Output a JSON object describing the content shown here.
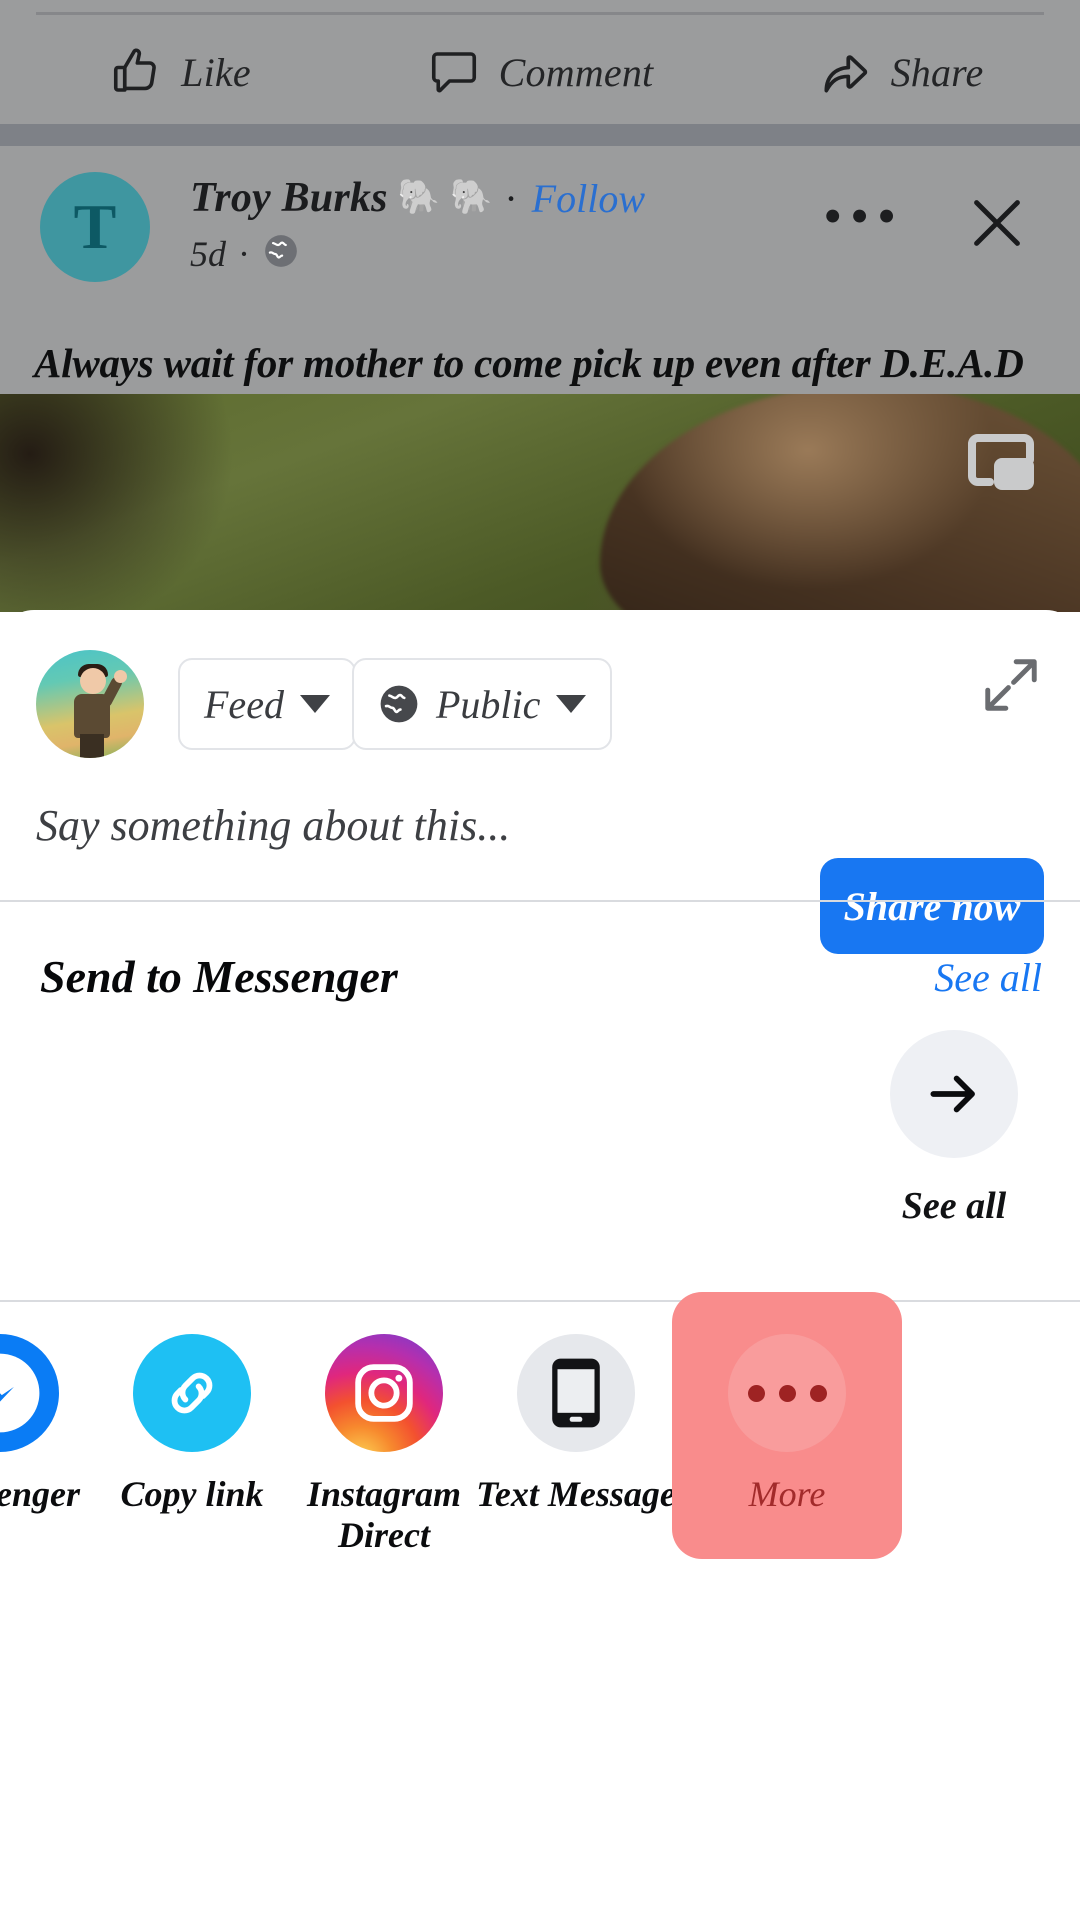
{
  "action_bar": {
    "items": [
      {
        "label": "Like",
        "icon": "thumbs-up-icon"
      },
      {
        "label": "Comment",
        "icon": "comment-bubble-icon"
      },
      {
        "label": "Share",
        "icon": "share-arrow-icon"
      }
    ]
  },
  "post": {
    "avatar_initial": "T",
    "author": "Troy Burks",
    "emoji": [
      "🐘",
      "🐘"
    ],
    "separator": "·",
    "follow_label": "Follow",
    "time": "5d",
    "time_separator": "·",
    "privacy_icon": "globe-icon",
    "more_icon": "ellipsis-icon",
    "close_icon": "close-icon",
    "text": "Always wait for  mother to come pick  up even after D.E.A.D",
    "pip_icon": "picture-in-picture-icon"
  },
  "composer": {
    "avatar": "user-avatar",
    "chips": [
      {
        "label": "Feed",
        "icon": null,
        "caret": "chevron-down-icon"
      },
      {
        "label": "Public",
        "icon": "globe-icon",
        "caret": "chevron-down-icon"
      }
    ],
    "placeholder": "Say something about this...",
    "expand_icon": "expand-arrows-icon",
    "share_now_label": "Share now"
  },
  "messenger": {
    "title": "Send to Messenger",
    "see_all_link": "See all",
    "see_all_tile": {
      "icon": "arrow-right-icon",
      "caption": "See all"
    }
  },
  "app_row": [
    {
      "name": "messenger",
      "label": "Messenger",
      "icon": "messenger-icon",
      "two_line": false
    },
    {
      "name": "copylink",
      "label": "Copy link",
      "icon": "link-icon",
      "two_line": false
    },
    {
      "name": "instagram",
      "label": "Instagram Direct",
      "icon": "instagram-icon",
      "two_line": true
    },
    {
      "name": "textmessage",
      "label": "Text Message",
      "icon": "phone-icon",
      "two_line": false
    },
    {
      "name": "more",
      "label": "More",
      "icon": "ellipsis-icon",
      "two_line": false
    }
  ],
  "colors": {
    "facebook_blue": "#1877f2",
    "link_blue": "#2a6fd0",
    "dim_backdrop": "#9b9c9d",
    "grey_band": "#7e8187",
    "avatar_teal": "#3f96a0",
    "more_highlight": "#f98c8c",
    "more_text": "#a22b2b"
  }
}
